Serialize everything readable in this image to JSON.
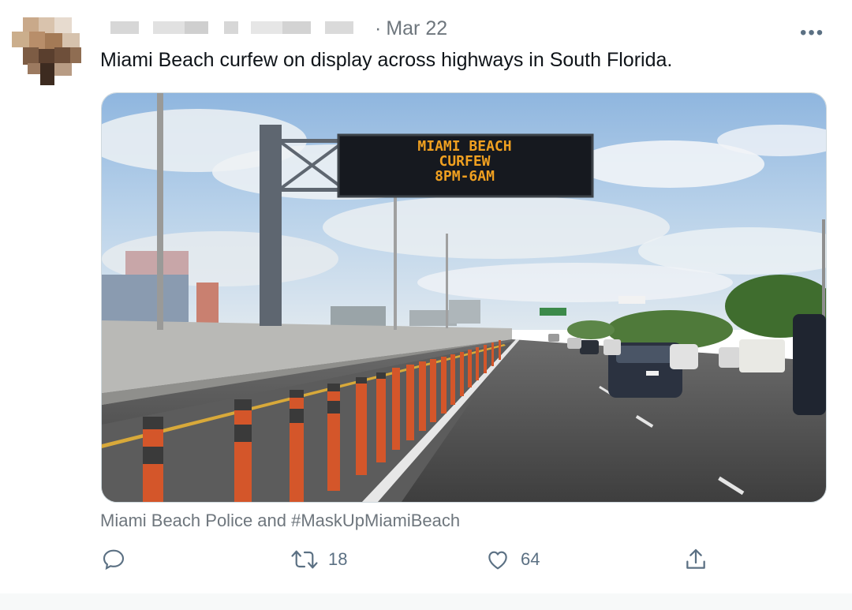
{
  "tweet": {
    "date": "Mar 22",
    "dot": "·",
    "text": "Miami Beach curfew on display across highways in South Florida.",
    "more_label": "•••",
    "caption": "Miami Beach Police and #MaskUpMiamiBeach"
  },
  "media": {
    "sign_lines": [
      "MIAMI BEACH",
      "CURFEW",
      "8PM-6AM"
    ]
  },
  "actions": {
    "reply_count": "",
    "retweet_count": "18",
    "like_count": "64"
  },
  "colors": {
    "text_primary": "#0f1419",
    "text_secondary": "#6e767d",
    "icon": "#5b7083",
    "sign_text": "#f0a020"
  },
  "icons": {
    "reply": "reply-icon",
    "retweet": "retweet-icon",
    "like": "like-icon",
    "share": "share-icon",
    "more": "more-icon"
  }
}
